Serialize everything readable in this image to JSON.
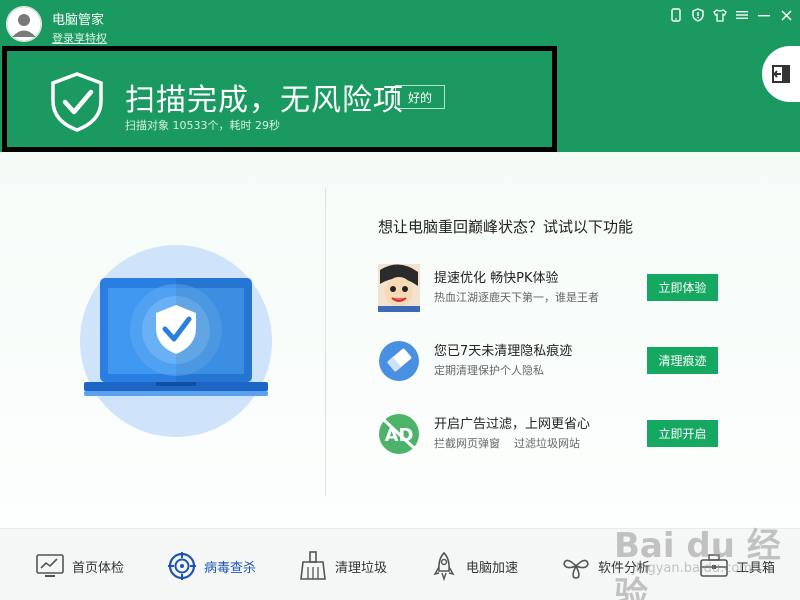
{
  "app": {
    "name": "电脑管家",
    "login_link": "登录享特权"
  },
  "window_controls": [
    {
      "name": "phone-icon",
      "glyph": "▯"
    },
    {
      "name": "shield-icon",
      "glyph": "◈"
    },
    {
      "name": "skin-icon",
      "glyph": "♜"
    },
    {
      "name": "menu-icon",
      "glyph": "≡"
    },
    {
      "name": "minimize-icon",
      "glyph": "—"
    },
    {
      "name": "close-icon",
      "glyph": "✕"
    }
  ],
  "result": {
    "title": "扫描完成，无风险项",
    "ok_label": "好的",
    "subtitle": "扫描对象 10533个，耗时 29秒"
  },
  "suggest": {
    "title": "想让电脑重回巅峰状态？试试以下功能",
    "items": [
      {
        "icon": "game-avatar-icon",
        "name": "提速优化 畅快PK体验",
        "desc": "热血江湖逐鹿天下第一，谁是王者",
        "button": "立即体验"
      },
      {
        "icon": "eraser-icon",
        "name": "您已7天未清理隐私痕迹",
        "desc": "定期清理保护个人隐私",
        "button": "清理痕迹"
      },
      {
        "icon": "ad-block-icon",
        "name": "开启广告过滤，上网更省心",
        "desc": "拦截网页弹窗    过滤垃圾网站",
        "button": "立即开启"
      }
    ]
  },
  "nav": {
    "items": [
      {
        "icon": "monitor-chart-icon",
        "label": "首页体检",
        "active": false
      },
      {
        "icon": "virus-scan-icon",
        "label": "病毒查杀",
        "active": true
      },
      {
        "icon": "broom-icon",
        "label": "清理垃圾",
        "active": false
      },
      {
        "icon": "rocket-icon",
        "label": "电脑加速",
        "active": false
      },
      {
        "icon": "software-icon",
        "label": "软件分析",
        "active": false
      },
      {
        "icon": "toolbox-icon",
        "label": "工具箱",
        "active": false
      }
    ]
  },
  "watermark": {
    "brand": "Bai du 经验",
    "url": "jingyan.baidu.com"
  },
  "colors": {
    "primary_green": "#1a9a61",
    "button_green": "#15a861",
    "active_nav_blue": "#1e55b3",
    "laptop_blue": "#2a7de1"
  }
}
